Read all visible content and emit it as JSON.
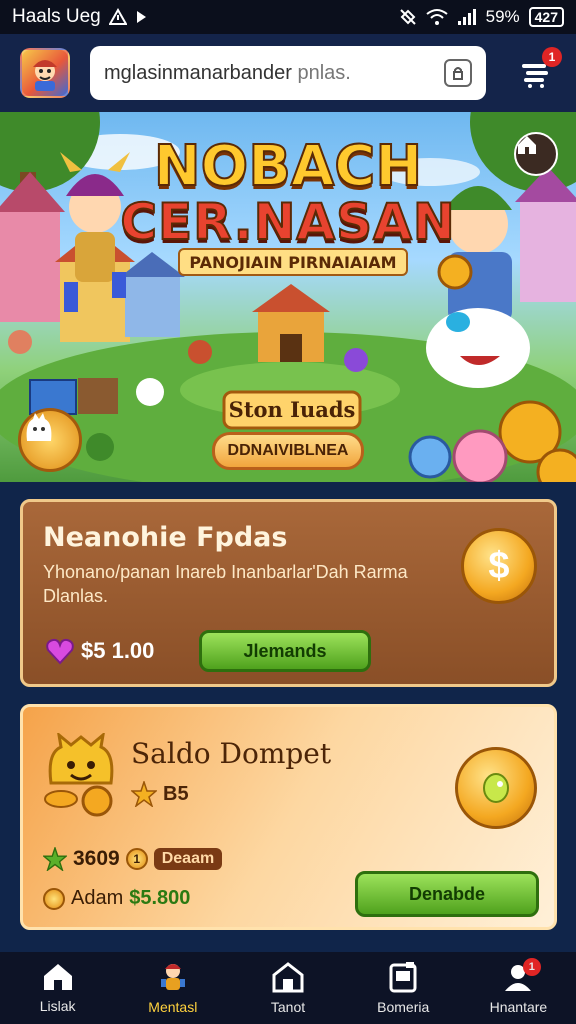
{
  "status_bar": {
    "carrier": "Haals Ueg",
    "battery_percent": "59%",
    "battery_label": "427"
  },
  "top_bar": {
    "url_main": "mglasinmanarbander",
    "url_faded": " pnlas.",
    "cart_badge": "1"
  },
  "banner": {
    "title_line1": "NOBACH",
    "title_line2": "CER.NASAN",
    "subtitle": "PANOJIAIN PIRNAIAIAM",
    "stage_label": "Ston Iuads",
    "cta_label": "DDNAIVIBLNEA"
  },
  "offer_card": {
    "title": "Neanohie Fpdas",
    "description": "Yhonano/panan Inareb Inanbarlar'Dah Rarma Dlanlas.",
    "price": "$5 1.00",
    "button_label": "Jlemands"
  },
  "wallet_card": {
    "title": "Saldo Dompet",
    "rating": "B5",
    "points": "3609",
    "points_badge": "1",
    "tag": "Deaam",
    "balance_label": "Adam",
    "balance_amount": "$5.800",
    "button_label": "Denabde"
  },
  "bottom_nav": [
    {
      "label": "Lislak",
      "icon": "home-icon",
      "active": false
    },
    {
      "label": "Mentasl",
      "icon": "character-icon",
      "active": true
    },
    {
      "label": "Tanot",
      "icon": "house-icon",
      "active": false
    },
    {
      "label": "Bomeria",
      "icon": "card-icon",
      "active": false
    },
    {
      "label": "Hnantare",
      "icon": "profile-icon",
      "active": false,
      "badge": "1"
    }
  ],
  "colors": {
    "nav_bg": "#0d1326",
    "accent_green": "#4fa21d",
    "card_brown": "#8a4f27",
    "gold": "#f4a821"
  }
}
